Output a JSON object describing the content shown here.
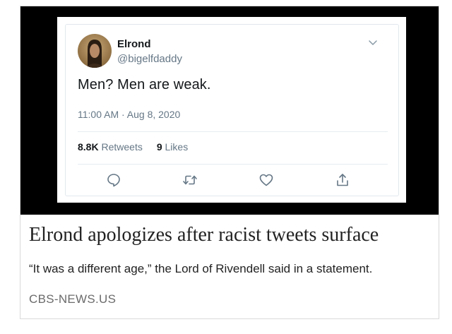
{
  "tweet": {
    "display_name": "Elrond",
    "handle": "@bigelfdaddy",
    "text": "Men? Men are weak.",
    "timestamp": "11:00 AM · Aug 8, 2020",
    "retweets_count": "8.8K",
    "retweets_label": "Retweets",
    "likes_count": "9",
    "likes_label": "Likes"
  },
  "article": {
    "headline": "Elrond apologizes after racist tweets surface",
    "subhead": "“It was a different age,” the Lord of Rivendell said in a statement.",
    "source": "CBS-NEWS.US"
  },
  "icons": {
    "menu": "chevron-down-icon",
    "reply": "reply-icon",
    "retweet": "retweet-icon",
    "like": "heart-icon",
    "share": "share-icon"
  },
  "colors": {
    "tweet_text": "#14171a",
    "tweet_secondary": "#657786",
    "icon": "#657786",
    "media_background": "#000000"
  }
}
